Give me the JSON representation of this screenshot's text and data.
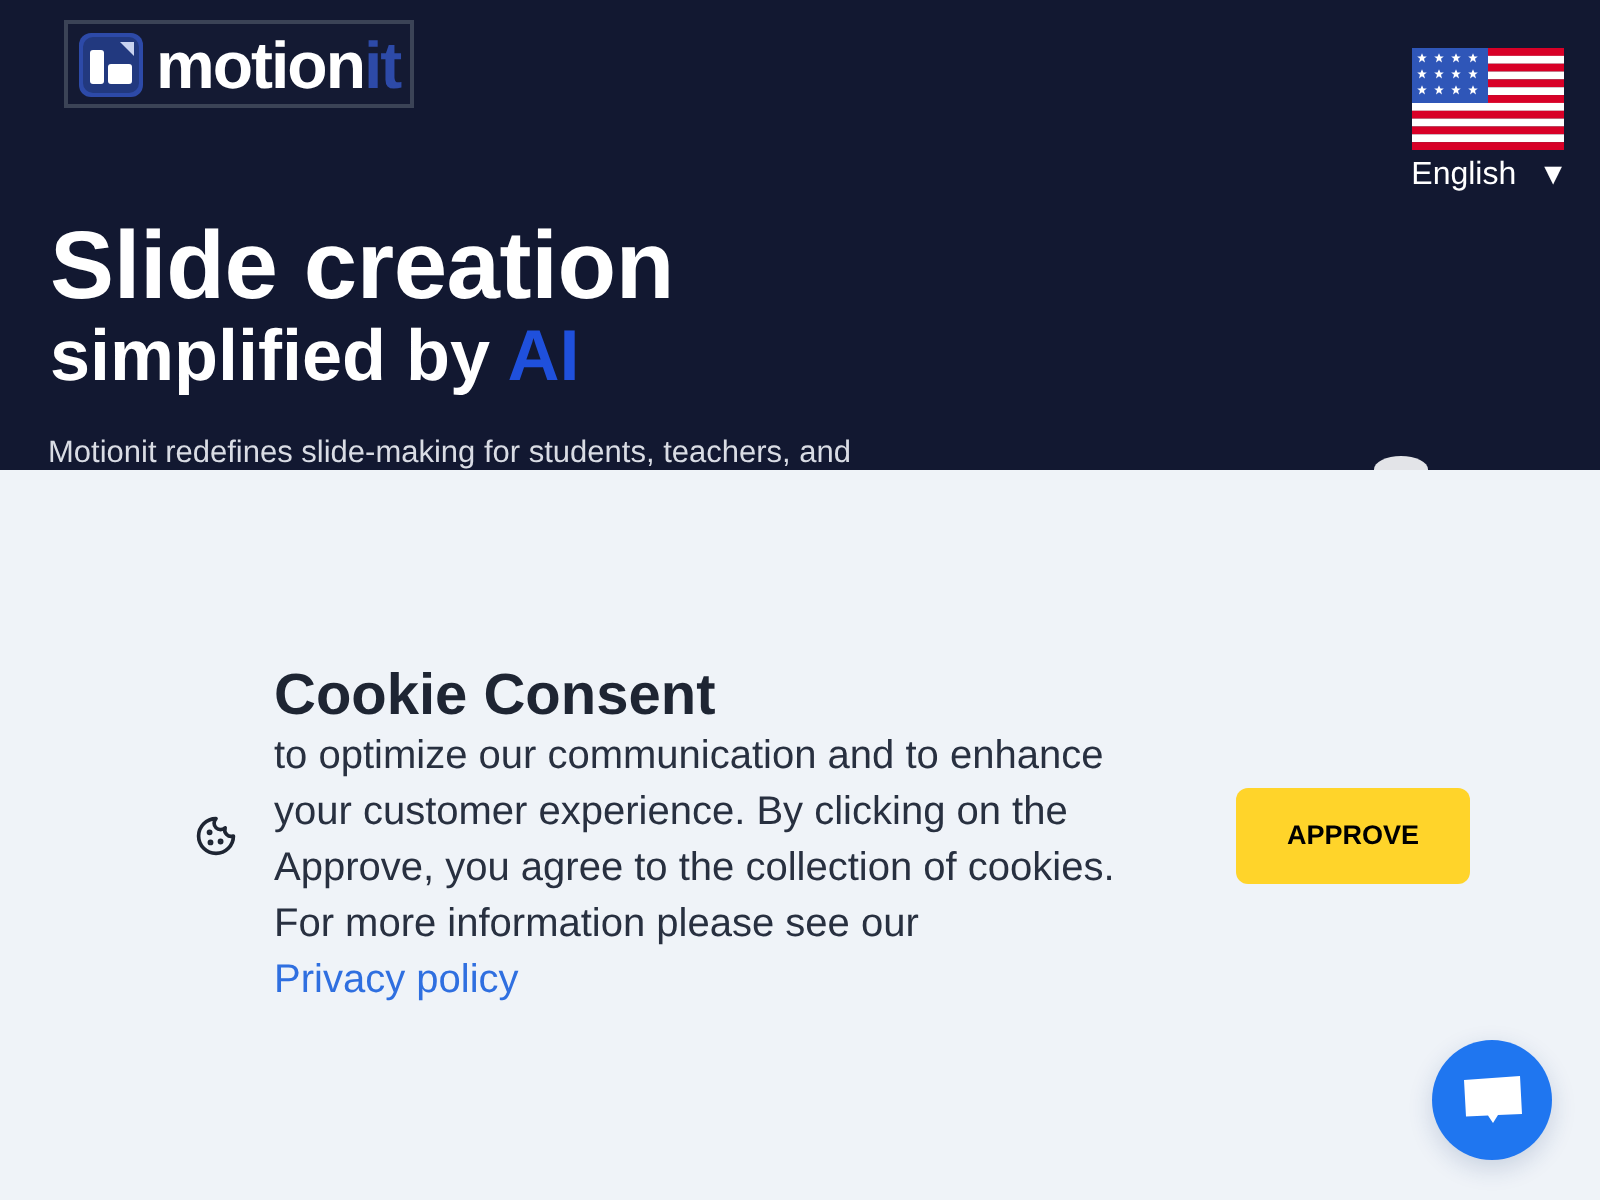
{
  "header": {
    "logo": {
      "name": "motion",
      "accent": "it"
    },
    "language": {
      "label": "English",
      "caret": "▼"
    }
  },
  "hero": {
    "title": "Slide creation",
    "subtitle": "simplified by",
    "subtitle_accent": "AI",
    "description": "Motionit redefines slide-making for students, teachers, and"
  },
  "cookie_banner": {
    "title": "Cookie Consent",
    "text": "to optimize our communication and to enhance your customer experience. By clicking on the Approve, you agree to the collection of cookies. For more information please see our",
    "link": "Privacy policy",
    "button": "APPROVE"
  }
}
